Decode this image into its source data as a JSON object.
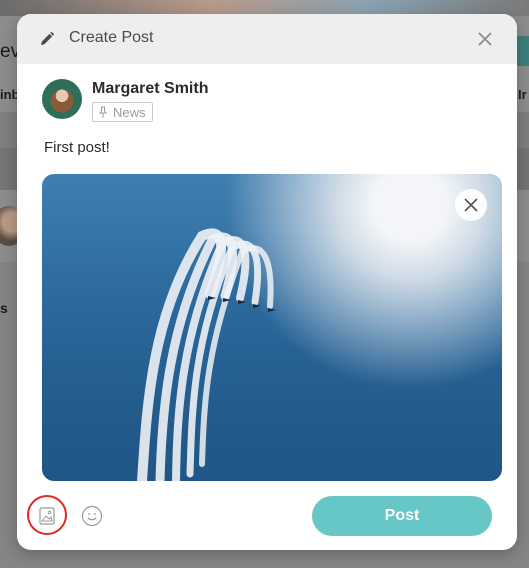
{
  "background": {
    "fragments": [
      "ev",
      "inb",
      "Ir",
      "s"
    ]
  },
  "modal": {
    "title": "Create Post",
    "header_icon": "pencil-icon",
    "close_icon": "close-icon"
  },
  "author": {
    "name": "Margaret Smith",
    "tag": "News",
    "tag_icon": "pin-icon"
  },
  "post": {
    "text": "First post!",
    "image_remove_icon": "close-icon"
  },
  "toolbar": {
    "image_icon": "image-icon",
    "emoji_icon": "smiley-icon",
    "post_label": "Post"
  },
  "colors": {
    "accent": "#67c6c6",
    "header_bg": "#eeeeee",
    "highlight": "#e02a20"
  }
}
